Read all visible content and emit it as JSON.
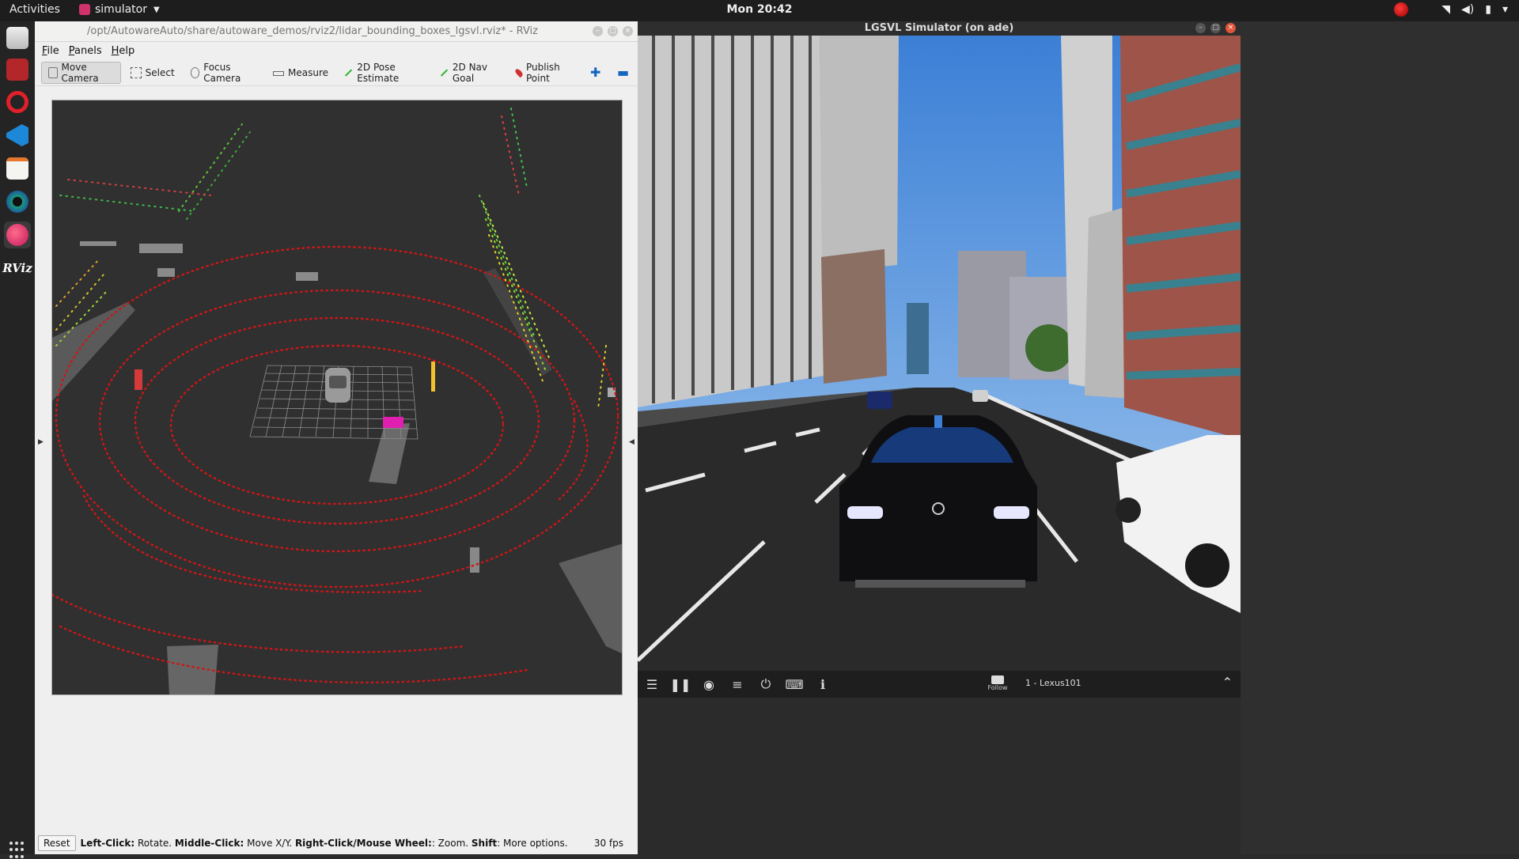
{
  "topbar": {
    "activities": "Activities",
    "app_name": "simulator",
    "clock": "Mon 20:42"
  },
  "dock": {
    "items": [
      "files-icon",
      "media-icon",
      "opera-icon",
      "vscode-icon",
      "text-editor-icon",
      "camera-app-icon",
      "simulator-icon",
      "rviz-icon"
    ],
    "rviz_label": "RViz"
  },
  "rviz": {
    "title": "/opt/AutowareAuto/share/autoware_demos/rviz2/lidar_bounding_boxes_lgsvl.rviz* - RViz",
    "menus": [
      "File",
      "Panels",
      "Help"
    ],
    "tools": {
      "move_camera": "Move Camera",
      "select": "Select",
      "focus_camera": "Focus Camera",
      "measure": "Measure",
      "pose_estimate": "2D Pose Estimate",
      "nav_goal": "2D Nav Goal",
      "publish_point": "Publish Point"
    },
    "status": {
      "reset": "Reset",
      "left_click_key": "Left-Click:",
      "left_click_val": " Rotate. ",
      "middle_click_key": "Middle-Click:",
      "middle_click_val": " Move X/Y. ",
      "right_click_key": "Right-Click/Mouse Wheel:",
      "right_click_val": ": Zoom. ",
      "shift_key": "Shift",
      "shift_val": ": More options.",
      "fps": "30 fps"
    }
  },
  "lgsvl": {
    "title": "LGSVL Simulator (on ade)",
    "follow_label": "Follow",
    "agent_label": "1 - Lexus101"
  }
}
